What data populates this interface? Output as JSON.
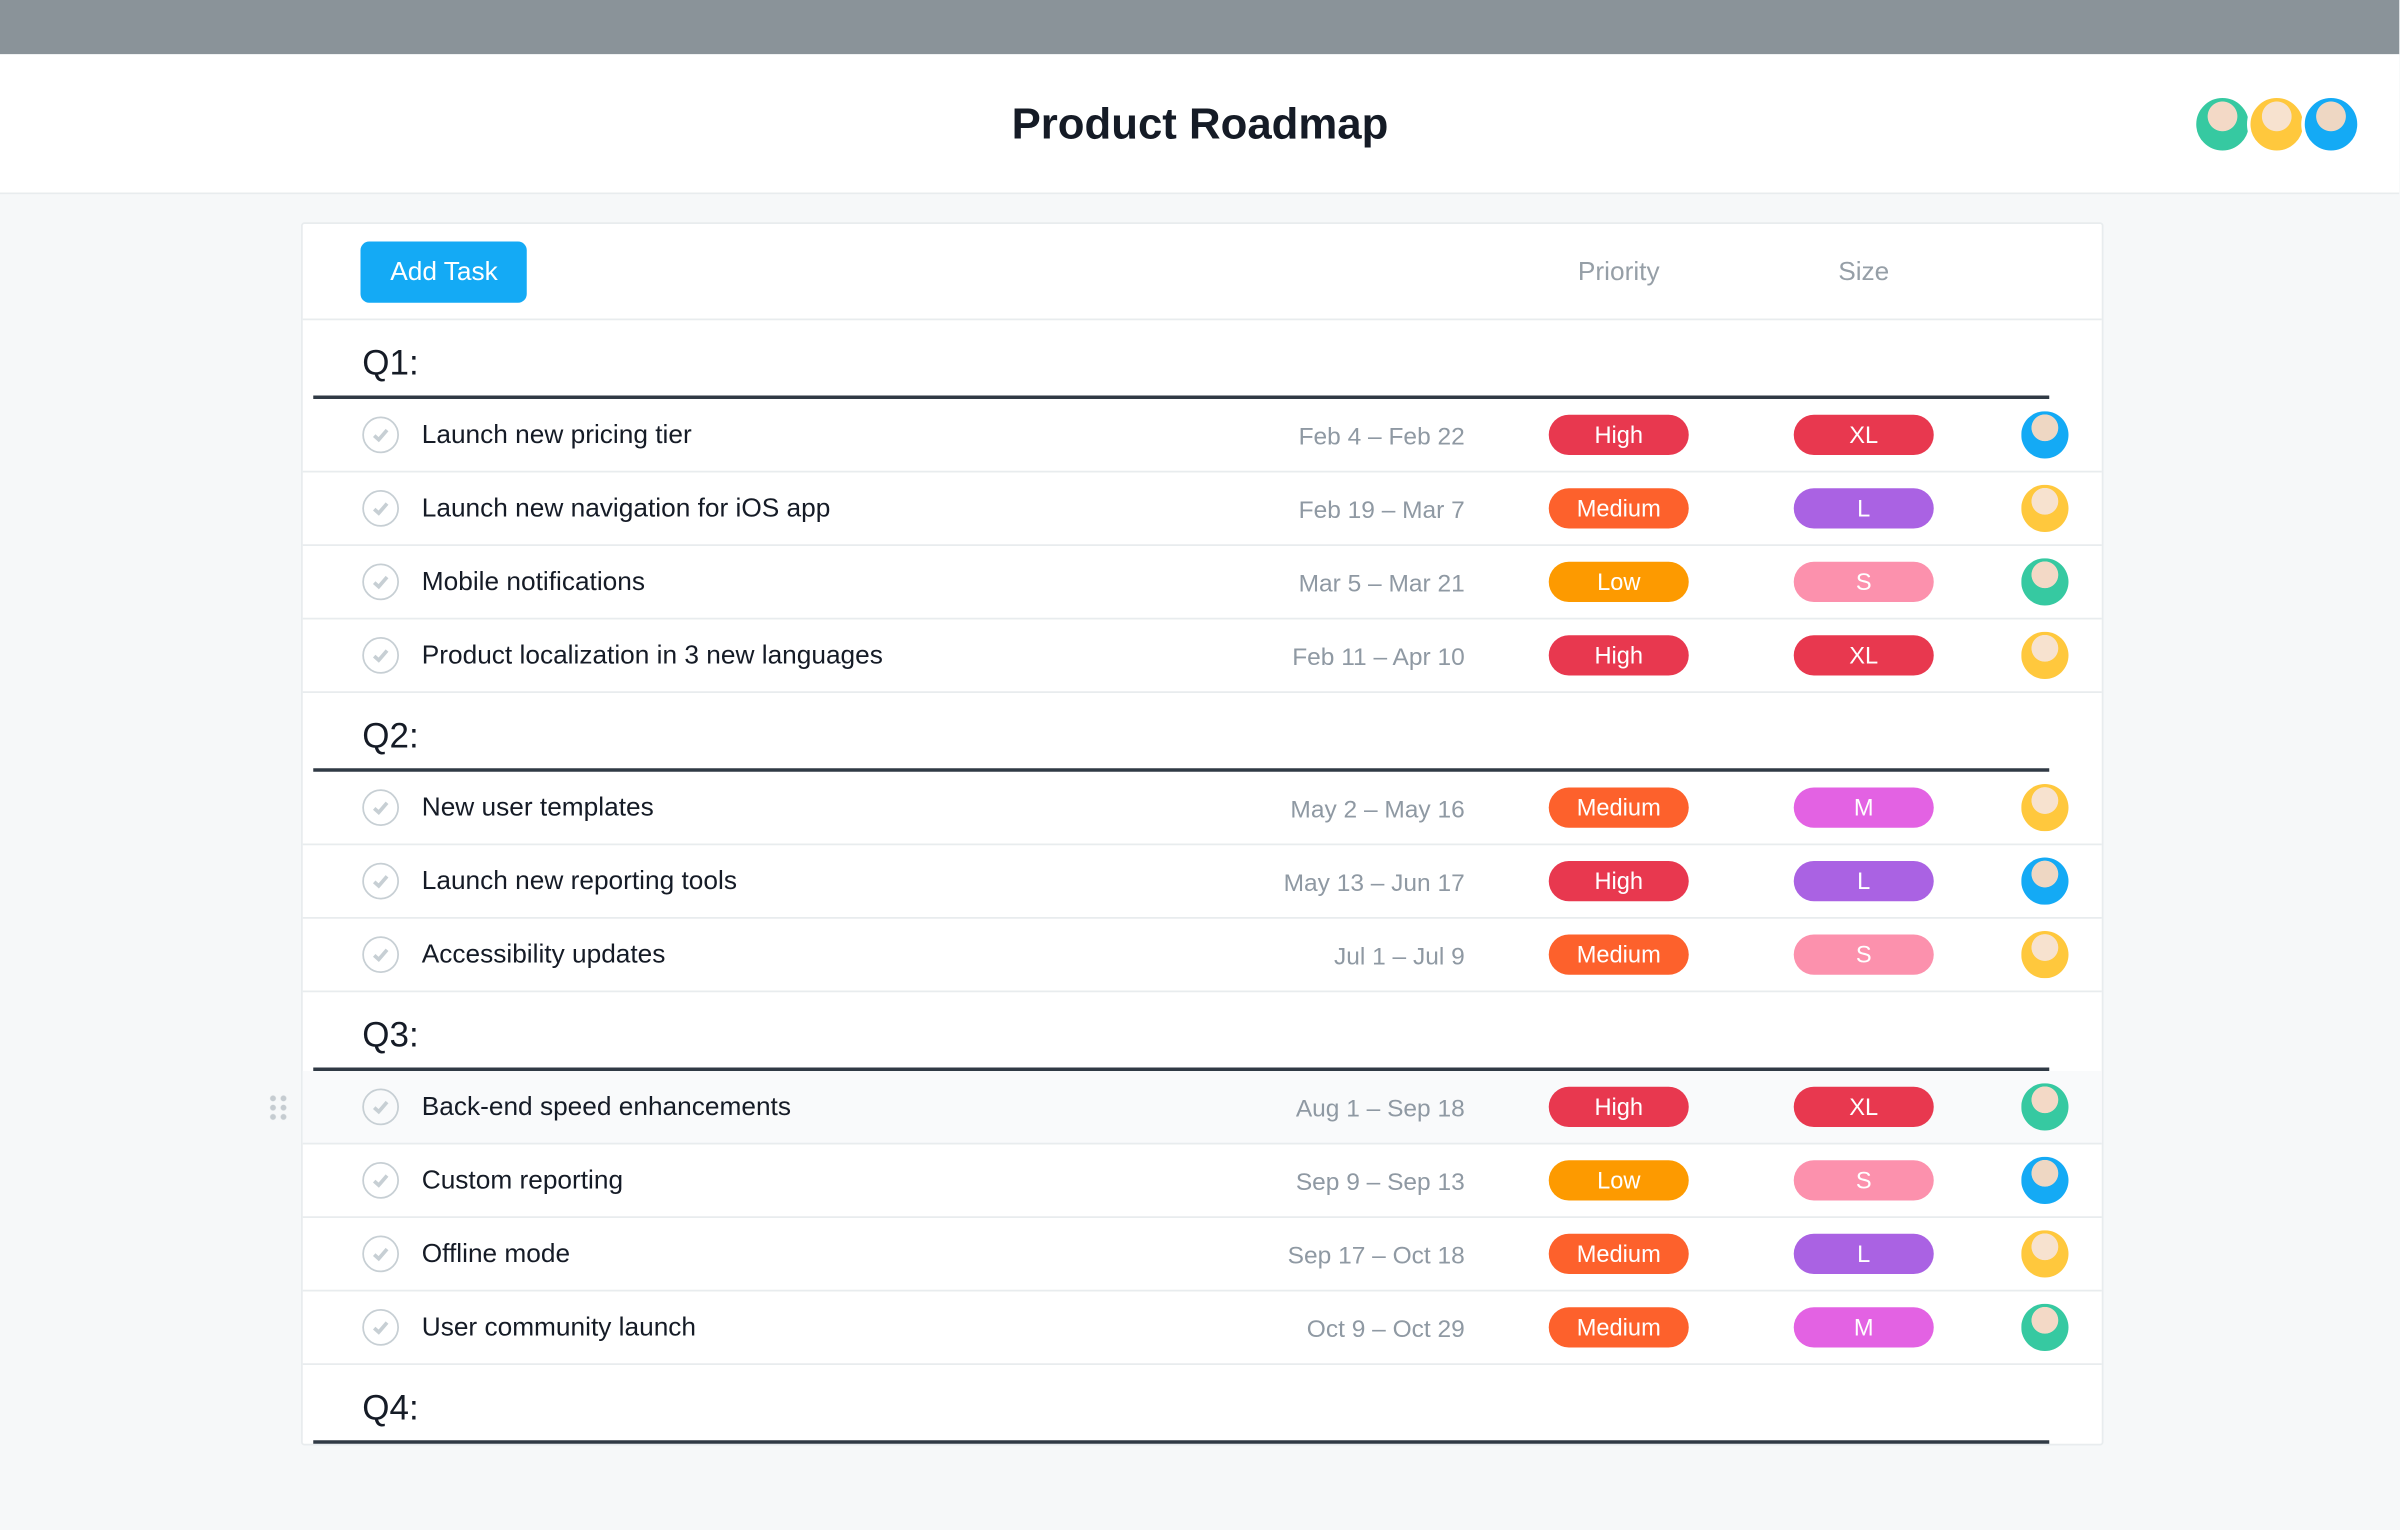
{
  "header": {
    "title": "Product Roadmap",
    "avatars": [
      "teal",
      "yellow",
      "blue"
    ]
  },
  "toolbar": {
    "add_task_label": "Add Task",
    "columns": {
      "priority": "Priority",
      "size": "Size"
    }
  },
  "colors": {
    "priority": {
      "High": "#e8384f",
      "Medium": "#fd612c",
      "Low": "#fd9a00"
    },
    "size": {
      "XL": "#e8384f",
      "L": "#aa62e3",
      "M": "#e362e3",
      "S": "#fc91ad"
    },
    "button": "#14aaf5"
  },
  "sections": [
    {
      "name": "Q1:",
      "tasks": [
        {
          "title": "Launch new pricing tier",
          "date": "Feb 4 – Feb 22",
          "priority": "High",
          "size": "XL",
          "assignee": "blue"
        },
        {
          "title": "Launch new navigation for iOS app",
          "date": "Feb 19 – Mar 7",
          "priority": "Medium",
          "size": "L",
          "assignee": "yellow"
        },
        {
          "title": "Mobile notifications",
          "date": "Mar 5 – Mar 21",
          "priority": "Low",
          "size": "S",
          "assignee": "teal"
        },
        {
          "title": "Product localization in 3 new languages",
          "date": "Feb 11 – Apr 10",
          "priority": "High",
          "size": "XL",
          "assignee": "yellow"
        }
      ]
    },
    {
      "name": "Q2:",
      "tasks": [
        {
          "title": "New user templates",
          "date": "May 2 – May 16",
          "priority": "Medium",
          "size": "M",
          "assignee": "yellow"
        },
        {
          "title": "Launch new reporting tools",
          "date": "May 13 – Jun 17",
          "priority": "High",
          "size": "L",
          "assignee": "blue"
        },
        {
          "title": "Accessibility updates",
          "date": "Jul 1 – Jul 9",
          "priority": "Medium",
          "size": "S",
          "assignee": "yellow"
        }
      ]
    },
    {
      "name": "Q3:",
      "tasks": [
        {
          "title": "Back-end speed enhancements",
          "date": "Aug 1 – Sep 18",
          "priority": "High",
          "size": "XL",
          "assignee": "teal",
          "hover": true
        },
        {
          "title": "Custom reporting",
          "date": "Sep 9 – Sep 13",
          "priority": "Low",
          "size": "S",
          "assignee": "blue"
        },
        {
          "title": "Offline mode",
          "date": "Sep 17 – Oct 18",
          "priority": "Medium",
          "size": "L",
          "assignee": "yellow"
        },
        {
          "title": "User community launch",
          "date": "Oct 9 – Oct 29",
          "priority": "Medium",
          "size": "M",
          "assignee": "teal"
        }
      ]
    },
    {
      "name": "Q4:",
      "tasks": []
    }
  ]
}
